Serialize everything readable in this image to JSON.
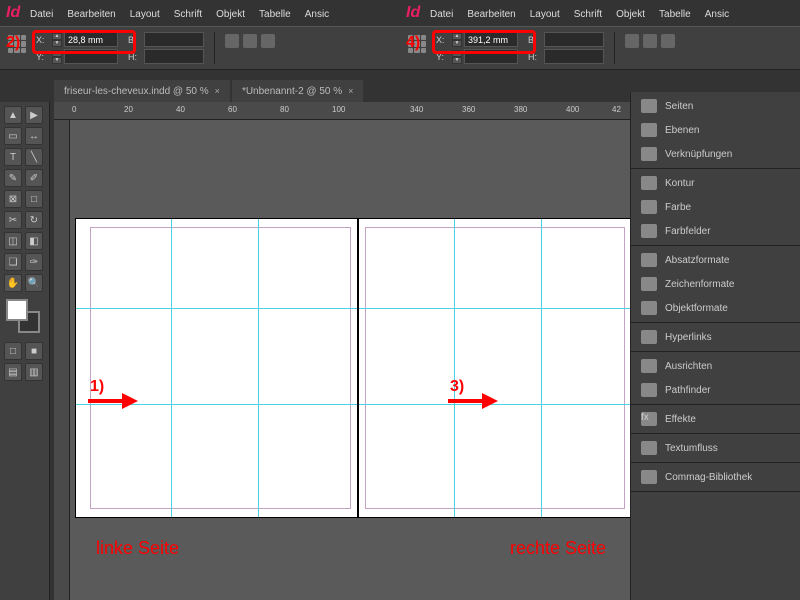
{
  "menu": {
    "items": [
      "Datei",
      "Bearbeiten",
      "Layout",
      "Schrift",
      "Objekt",
      "Tabelle",
      "Ansic"
    ]
  },
  "left": {
    "x": "28,8 mm",
    "y": ""
  },
  "right": {
    "x": "391,2 mm",
    "y": ""
  },
  "annotations": {
    "l2": "2)",
    "l4": "4)",
    "a1": "1)",
    "a3": "3)",
    "leftPage": "linke Seite",
    "rightPage": "rechte Seite"
  },
  "tabs": [
    {
      "label": "friseur-les-cheveux.indd @ 50 %"
    },
    {
      "label": "*Unbenannt-2 @ 50 %"
    }
  ],
  "rulerLeft": [
    "0",
    "20",
    "40",
    "60",
    "80",
    "100"
  ],
  "rulerRight": [
    "340",
    "360",
    "380",
    "400",
    "42"
  ],
  "panels": [
    {
      "group": [
        {
          "label": "Seiten"
        },
        {
          "label": "Ebenen"
        },
        {
          "label": "Verknüpfungen"
        }
      ]
    },
    {
      "group": [
        {
          "label": "Kontur"
        },
        {
          "label": "Farbe"
        },
        {
          "label": "Farbfelder"
        }
      ]
    },
    {
      "group": [
        {
          "label": "Absatzformate"
        },
        {
          "label": "Zeichenformate"
        },
        {
          "label": "Objektformate"
        }
      ]
    },
    {
      "group": [
        {
          "label": "Hyperlinks"
        }
      ]
    },
    {
      "group": [
        {
          "label": "Ausrichten"
        },
        {
          "label": "Pathfinder"
        }
      ]
    },
    {
      "group": [
        {
          "label": "Effekte"
        }
      ]
    },
    {
      "group": [
        {
          "label": "Textumfluss"
        }
      ]
    },
    {
      "group": [
        {
          "label": "Commag-Bibliothek"
        }
      ]
    }
  ]
}
